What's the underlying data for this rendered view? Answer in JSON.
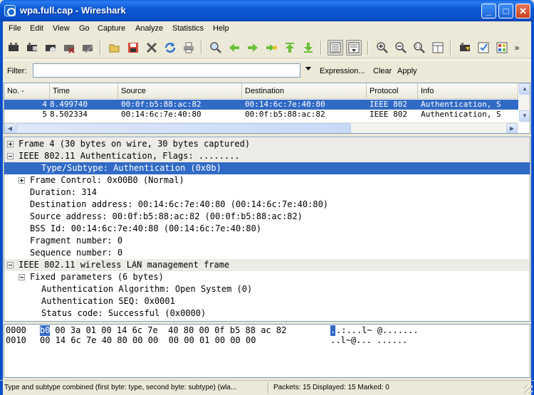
{
  "window": {
    "title": "wpa.full.cap - Wireshark"
  },
  "menu": [
    "File",
    "Edit",
    "View",
    "Go",
    "Capture",
    "Analyze",
    "Statistics",
    "Help"
  ],
  "toolbar": {
    "icons": [
      "interface-list-icon",
      "capture-options-icon",
      "start-capture-icon",
      "stop-capture-icon",
      "restart-capture-icon",
      "open-icon",
      "save-icon",
      "close-icon",
      "reload-icon",
      "print-icon",
      "find-icon",
      "back-icon",
      "forward-icon",
      "go-to-icon",
      "first-packet-icon",
      "last-packet-icon",
      "colorize-icon",
      "auto-scroll-icon",
      "zoom-in-icon",
      "zoom-out-icon",
      "zoom-100-icon",
      "resize-columns-icon",
      "capture-filters-icon",
      "display-filters-icon",
      "coloring-rules-icon",
      "preferences-icon"
    ],
    "more": "»"
  },
  "filter": {
    "label": "Filter:",
    "value": "",
    "expression_label": "Expression...",
    "clear_label": "Clear",
    "apply_label": "Apply"
  },
  "packet_list": {
    "columns": [
      "No. -",
      "Time",
      "Source",
      "Destination",
      "Protocol",
      "Info"
    ],
    "rows": [
      {
        "no": "4",
        "time": "8.499740",
        "source": "00:0f:b5:88:ac:82",
        "destination": "00:14:6c:7e:40:80",
        "protocol": "IEEE 802",
        "info": "Authentication, S",
        "selected": true
      },
      {
        "no": "5",
        "time": "8.502334",
        "source": "00:14:6c:7e:40:80",
        "destination": "00:0f:b5:88:ac:82",
        "protocol": "IEEE 802",
        "info": "Authentication, S",
        "selected": false
      }
    ]
  },
  "details": {
    "rows": [
      {
        "indent": 0,
        "expander": "plus",
        "text": "Frame 4 (30 bytes on wire, 30 bytes captured)",
        "band": true
      },
      {
        "indent": 0,
        "expander": "minus",
        "text": "IEEE 802.11 Authentication, Flags: ........",
        "band": true
      },
      {
        "indent": 1,
        "expander": "",
        "text": "Type/Subtype: Authentication (0x0b)",
        "highlight": true
      },
      {
        "indent": 1,
        "expander": "plus",
        "text": "Frame Control: 0x00B0 (Normal)"
      },
      {
        "indent": 1,
        "expander": "",
        "text": "Duration: 314"
      },
      {
        "indent": 1,
        "expander": "",
        "text": "Destination address: 00:14:6c:7e:40:80 (00:14:6c:7e:40:80)"
      },
      {
        "indent": 1,
        "expander": "",
        "text": "Source address: 00:0f:b5:88:ac:82 (00:0f:b5:88:ac:82)"
      },
      {
        "indent": 1,
        "expander": "",
        "text": "BSS Id: 00:14:6c:7e:40:80 (00:14:6c:7e:40:80)"
      },
      {
        "indent": 1,
        "expander": "",
        "text": "Fragment number: 0"
      },
      {
        "indent": 1,
        "expander": "",
        "text": "Sequence number: 0"
      },
      {
        "indent": 0,
        "expander": "minus",
        "text": "IEEE 802.11 wireless LAN management frame",
        "band": true
      },
      {
        "indent": 1,
        "expander": "minus",
        "text": "Fixed parameters (6 bytes)"
      },
      {
        "indent": 2,
        "expander": "",
        "text": "Authentication Algorithm: Open System (0)"
      },
      {
        "indent": 2,
        "expander": "",
        "text": "Authentication SEQ: 0x0001"
      },
      {
        "indent": 2,
        "expander": "",
        "text": "Status code: Successful (0x0000)"
      }
    ]
  },
  "bytes": {
    "rows": [
      {
        "offset": "0000",
        "hl_hex": "b0",
        "hex": " 00 3a 01 00 14 6c 7e  40 80 00 0f b5 88 ac 82",
        "hl_ascii": ".",
        "ascii": ".:...l~ @......."
      },
      {
        "offset": "0010",
        "hl_hex": "",
        "hex": "00 14 6c 7e 40 80 00 00  00 00 01 00 00 00",
        "hl_ascii": "",
        "ascii": "..l~@... ......"
      }
    ]
  },
  "status": {
    "left": "Type and subtype combined (first byte: type, second byte: subtype) (wla...",
    "right": "Packets: 15 Displayed: 15 Marked: 0"
  }
}
